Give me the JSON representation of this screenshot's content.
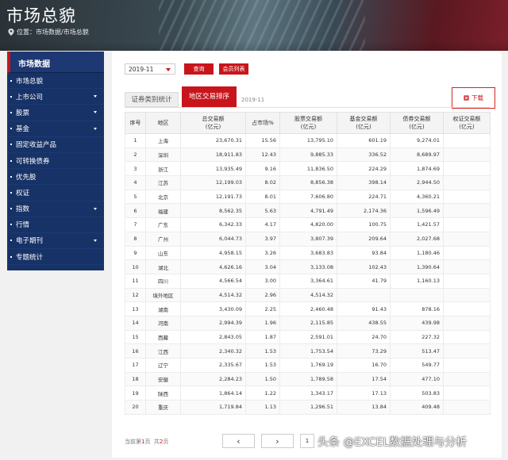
{
  "header": {
    "title": "市场总貌",
    "breadcrumb": "位置：市场数据/市场总貌"
  },
  "sidebar": {
    "title": "市场数据",
    "items": [
      {
        "label": "市场总貌",
        "has_caret": false
      },
      {
        "label": "上市公司",
        "has_caret": true
      },
      {
        "label": "股票",
        "has_caret": true
      },
      {
        "label": "基金",
        "has_caret": true
      },
      {
        "label": "固定收益产品",
        "has_caret": false
      },
      {
        "label": "可转换债券",
        "has_caret": false
      },
      {
        "label": "优先股",
        "has_caret": false
      },
      {
        "label": "权证",
        "has_caret": false
      },
      {
        "label": "指数",
        "has_caret": true
      },
      {
        "label": "行情",
        "has_caret": false
      },
      {
        "label": "电子期刊",
        "has_caret": true
      },
      {
        "label": "专题统计",
        "has_caret": false
      }
    ]
  },
  "controls": {
    "month_value": "2019-11",
    "query_label": "查询",
    "members_label": "会员列表"
  },
  "tabs": {
    "category_label": "证券类别统计",
    "region_label": "地区交易排序",
    "date": "2019-11",
    "download_label": "下载"
  },
  "table": {
    "headers": [
      "序号",
      "地区",
      "总交易额\n(亿元)",
      "占市场%",
      "股票交易额\n(亿元)",
      "基金交易额\n(亿元)",
      "债券交易额\n(亿元)",
      "权证交易额\n(亿元)"
    ],
    "rows": [
      [
        "1",
        "上海",
        "23,670.31",
        "15.56",
        "13,795.10",
        "601.19",
        "9,274.01",
        ""
      ],
      [
        "2",
        "深圳",
        "18,911.83",
        "12.43",
        "9,885.33",
        "336.52",
        "8,689.97",
        ""
      ],
      [
        "3",
        "浙江",
        "13,935.49",
        "9.16",
        "11,836.50",
        "224.29",
        "1,874.69",
        ""
      ],
      [
        "4",
        "江苏",
        "12,199.03",
        "8.02",
        "8,856.38",
        "398.14",
        "2,944.50",
        ""
      ],
      [
        "5",
        "北京",
        "12,191.73",
        "8.01",
        "7,606.80",
        "224.71",
        "4,360.21",
        ""
      ],
      [
        "6",
        "福建",
        "8,562.35",
        "5.63",
        "4,791.49",
        "2,174.36",
        "1,596.49",
        ""
      ],
      [
        "7",
        "广东",
        "6,342.33",
        "4.17",
        "4,820.00",
        "100.75",
        "1,421.57",
        ""
      ],
      [
        "8",
        "广州",
        "6,044.73",
        "3.97",
        "3,807.39",
        "209.64",
        "2,027.68",
        ""
      ],
      [
        "9",
        "山东",
        "4,958.15",
        "3.26",
        "3,683.83",
        "93.84",
        "1,180.46",
        ""
      ],
      [
        "10",
        "湖北",
        "4,626.16",
        "3.04",
        "3,133.08",
        "102.43",
        "1,390.64",
        ""
      ],
      [
        "11",
        "四川",
        "4,566.54",
        "3.00",
        "3,364.61",
        "41.79",
        "1,160.13",
        ""
      ],
      [
        "12",
        "境外地区",
        "4,514.32",
        "2.96",
        "4,514.32",
        "",
        "",
        ""
      ],
      [
        "13",
        "湖南",
        "3,430.09",
        "2.25",
        "2,460.48",
        "91.43",
        "878.16",
        ""
      ],
      [
        "14",
        "河南",
        "2,994.39",
        "1.96",
        "2,115.85",
        "438.55",
        "439.98",
        ""
      ],
      [
        "15",
        "西藏",
        "2,843.05",
        "1.87",
        "2,591.01",
        "24.70",
        "227.32",
        ""
      ],
      [
        "16",
        "江西",
        "2,340.32",
        "1.53",
        "1,753.54",
        "73.29",
        "513.47",
        ""
      ],
      [
        "17",
        "辽宁",
        "2,335.67",
        "1.53",
        "1,769.19",
        "16.70",
        "549.77",
        ""
      ],
      [
        "18",
        "安徽",
        "2,284.23",
        "1.50",
        "1,789.58",
        "17.54",
        "477.10",
        ""
      ],
      [
        "19",
        "陕西",
        "1,864.14",
        "1.22",
        "1,343.17",
        "17.13",
        "503.83",
        ""
      ],
      [
        "20",
        "重庆",
        "1,719.84",
        "1.13",
        "1,296.51",
        "13.84",
        "409.48",
        ""
      ]
    ]
  },
  "pagination": {
    "current_prefix": "当前第",
    "current": "1",
    "page_unit": "页",
    "total_prefix": "共",
    "total": "2",
    "page_input": "1",
    "prev_glyph": "‹",
    "next_glyph": "›"
  },
  "watermark": "头条 @EXCEL数据处理与分析"
}
